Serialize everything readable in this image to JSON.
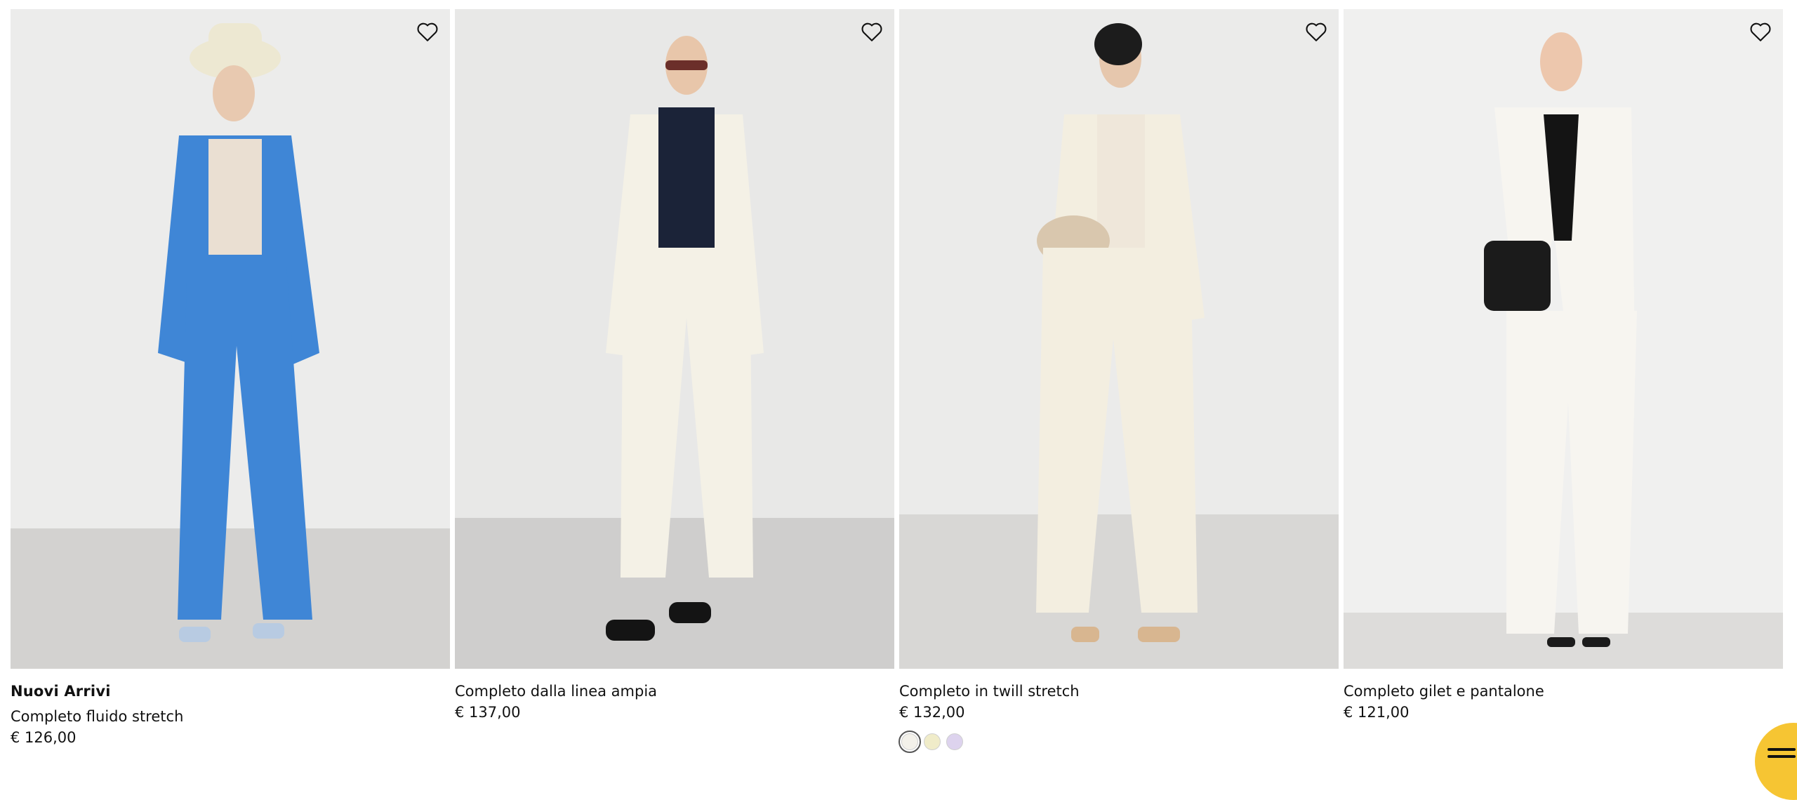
{
  "products": [
    {
      "badge": "Nuovi Arrivi",
      "name": "Completo fluido stretch",
      "price": "€ 126,00",
      "wall_color": "#ececeb",
      "floor_color": "#d3d2d0",
      "suit_color": "#3f86d6",
      "top_color": "#eadfd2",
      "swatches": []
    },
    {
      "badge": "",
      "name": "Completo dalla linea ampia",
      "price": "€ 137,00",
      "wall_color": "#e8e8e7",
      "floor_color": "#cfcecd",
      "suit_color": "#f4f1e6",
      "top_color": "#1b2338",
      "swatches": []
    },
    {
      "badge": "",
      "name": "Completo in twill stretch",
      "price": "€ 132,00",
      "wall_color": "#ebebea",
      "floor_color": "#d8d7d5",
      "suit_color": "#f3eee0",
      "top_color": "#efe7da",
      "swatches": [
        {
          "color": "#f3f1ea",
          "selected": true
        },
        {
          "color": "#f0ecc9",
          "selected": false
        },
        {
          "color": "#ddd3ee",
          "selected": false
        }
      ]
    },
    {
      "badge": "",
      "name": "Completo gilet e pantalone",
      "price": "€ 121,00",
      "wall_color": "#f0f0ef",
      "floor_color": "#dddcda",
      "suit_color": "#f7f5f0",
      "top_color": "#141414",
      "swatches": []
    }
  ],
  "colors": {
    "heart_stroke": "#111111",
    "chat_bubble": "#f6c533"
  },
  "icons": {
    "favorite": "heart-outline-icon",
    "chat": "chat-lines-icon"
  }
}
